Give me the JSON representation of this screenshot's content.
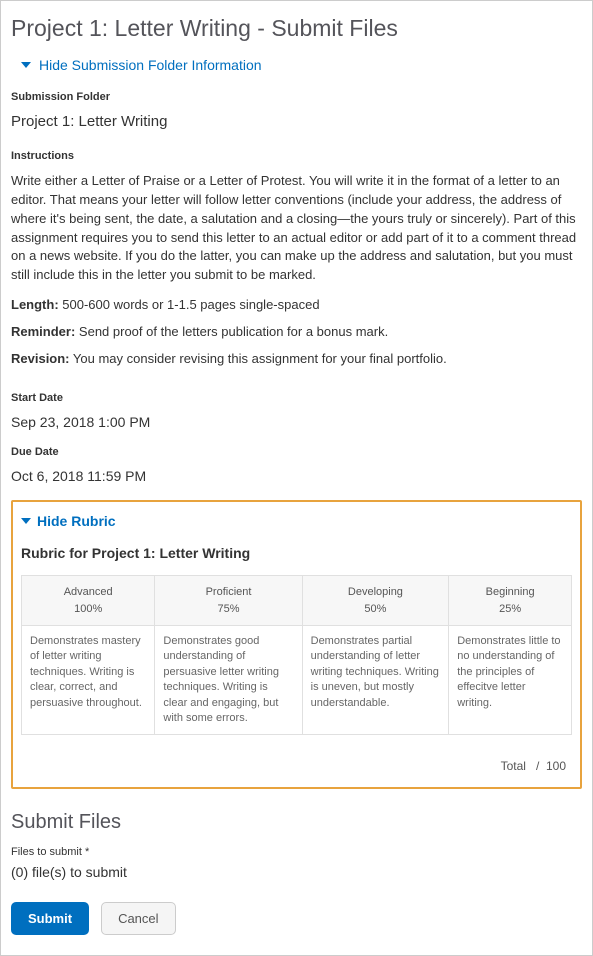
{
  "header": {
    "title": "Project 1: Letter Writing - Submit Files",
    "hide_info_label": "Hide Submission Folder Information"
  },
  "folder": {
    "label": "Submission Folder",
    "name": "Project 1: Letter Writing"
  },
  "instructions": {
    "label": "Instructions",
    "body": "Write either a Letter of Praise or a Letter of Protest. You will write it in the format of a letter to an editor. That means your letter will follow letter conventions (include your address, the address of where it's being sent, the date, a salutation and a closing—the yours truly or sincerely). Part of this assignment requires you to send this letter to an actual editor or add part of it to a comment thread on a news website. If you do the latter, you can make up the address and salutation, but you must still include this in the letter you submit to be marked.",
    "length_label": "Length:",
    "length_value": "500-600 words or 1-1.5 pages single-spaced",
    "reminder_label": "Reminder:",
    "reminder_value": "Send proof of the letters publication for a bonus mark.",
    "revision_label": "Revision:",
    "revision_value": "You may consider revising this assignment for your final portfolio."
  },
  "dates": {
    "start_label": "Start Date",
    "start_value": "Sep 23, 2018 1:00 PM",
    "due_label": "Due Date",
    "due_value": "Oct 6, 2018 11:59 PM"
  },
  "rubric": {
    "hide_label": "Hide Rubric",
    "title": "Rubric for Project 1: Letter Writing",
    "levels": [
      {
        "name": "Advanced",
        "pct": "100%",
        "desc": "Demonstrates mastery of letter writing techniques. Writing is clear, correct, and persuasive throughout."
      },
      {
        "name": "Proficient",
        "pct": "75%",
        "desc": "Demonstrates good understanding of persuasive letter writing techniques. Writing is clear and engaging, but with some errors."
      },
      {
        "name": "Developing",
        "pct": "50%",
        "desc": "Demonstrates partial understanding of letter writing techniques. Writing is uneven, but mostly understandable."
      },
      {
        "name": "Beginning",
        "pct": "25%",
        "desc": "Demonstrates little to no understanding of the principles of effecitve letter writing."
      }
    ],
    "total_label": "Total",
    "total_sep": "/",
    "total_max": "100"
  },
  "submit": {
    "heading": "Submit Files",
    "files_label": "Files to submit *",
    "files_count": "(0) file(s) to submit",
    "submit_btn": "Submit",
    "cancel_btn": "Cancel"
  }
}
